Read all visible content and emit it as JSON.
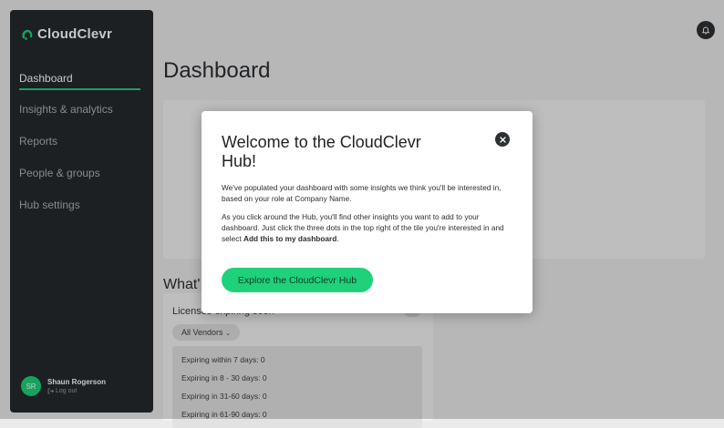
{
  "app": {
    "brand": "CloudClevr"
  },
  "sidebar": {
    "items": [
      {
        "label": "Dashboard"
      },
      {
        "label": "Insights & analytics"
      },
      {
        "label": "Reports"
      },
      {
        "label": "People & groups"
      },
      {
        "label": "Hub settings"
      }
    ],
    "user": {
      "initials": "SR",
      "name": "Shaun Rogerson",
      "logout": "Log out"
    }
  },
  "main": {
    "title": "Dashboard",
    "section_heading": "What'",
    "card": {
      "title": "Licenses expiring soon",
      "vendor_filter": "All Vendors",
      "rows": [
        "Expiring within 7 days: 0",
        "Expiring in 8 - 30 days: 0",
        "Expiring in 31-60 days: 0",
        "Expiring in 61-90 days: 0"
      ]
    }
  },
  "modal": {
    "title": "Welcome to the CloudClevr Hub!",
    "p1": "We've populated your dashboard with some insights we think you'll be interested in, based on your role at Company Name.",
    "p2_a": "As you click around the Hub, you'll find other insights you want to add to your dashboard. Just click the three dots in the top right of the tile you're interested in and select ",
    "p2_bold": "Add this to my dashboard",
    "p2_end": ".",
    "cta": "Explore the CloudClevr Hub"
  },
  "colors": {
    "sidebar_bg": "#25292c",
    "accent": "#1ed17a",
    "page_bg": "#ebebeb"
  },
  "icons": {
    "logo": "cloudclevr-logo-icon",
    "bell": "bell-icon",
    "close": "close-icon",
    "logout": "logout-icon",
    "dropdown": "chevron-down-icon"
  }
}
